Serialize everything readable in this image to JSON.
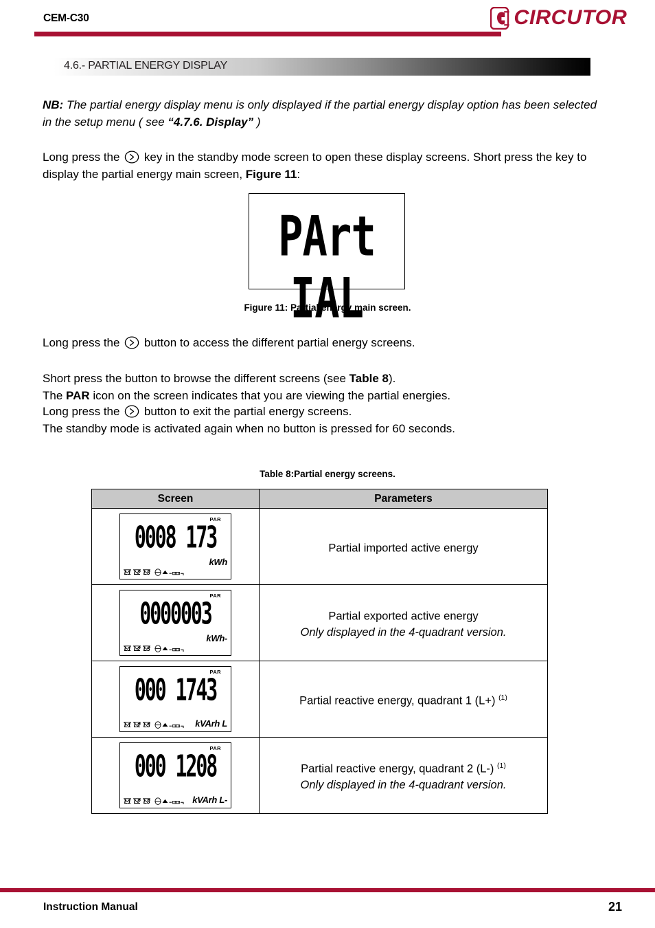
{
  "header": {
    "doc_title": "CEM-C30",
    "brand": "CIRCUTOR",
    "brand_color": "#A81133",
    "rule_color": "#A81133"
  },
  "section": {
    "number": "4.6.-",
    "title": "4.6.- PARTIAL ENERGY DISPLAY"
  },
  "note": {
    "label": "NB:",
    "text_part1": "The partial energy display menu is only displayed if the partial energy display option has been selected in the setup menu ( see ",
    "reference": "“4.7.6. Display”",
    "text_part2": " )"
  },
  "paragraphs": {
    "p1_a": "Long press the ",
    "p1_b": " key in the standby mode screen to open these display screens. Short press the key to display the partial energy main screen, ",
    "p1_bold": "Figure 11",
    "p1_c": ":",
    "p2_a": "Long press the ",
    "p2_b": " button to access the different partial energy screens.",
    "p3_a": "Short press the button to browse the different screens (see ",
    "p3_bold": "Table 8",
    "p3_b": ").",
    "p3_c": "The ",
    "p3_bold2": "PAR",
    "p3_d": " icon on the screen indicates that you are viewing the partial energies.",
    "p4_a": "Long press the ",
    "p4_b": " button to exit the partial energy screens.",
    "p4_c": "The standby mode is activated again when no button is pressed for 60 seconds."
  },
  "figure": {
    "lcd_text": "PArt IAL",
    "caption": "Figure 11: Partial energy main screen."
  },
  "table": {
    "caption": "Table 8:Partial energy screens.",
    "headers": [
      "Screen",
      "Parameters"
    ],
    "rows": [
      {
        "screen": {
          "par": "PAR",
          "digits": "0008 173",
          "phases": [
            "L1",
            "L2",
            "L3"
          ],
          "unit": "kWh",
          "unit_position": "top"
        },
        "param_line1": "Partial imported active energy",
        "param_line2": "",
        "note_marker": ""
      },
      {
        "screen": {
          "par": "PAR",
          "digits": "0000003",
          "phases": [
            "L1",
            "L2",
            "L3"
          ],
          "unit": "kWh-",
          "unit_position": "top"
        },
        "param_line1": "Partial exported active energy",
        "param_line2": "Only displayed in the 4-quadrant version.",
        "note_marker": ""
      },
      {
        "screen": {
          "par": "PAR",
          "digits": "000 1743",
          "phases": [
            "L1",
            "L2",
            "L3"
          ],
          "unit": "kVArh L",
          "unit_position": "bottom"
        },
        "param_line1": "Partial reactive energy, quadrant 1 (L+)",
        "param_line2": "",
        "note_marker": "(1)"
      },
      {
        "screen": {
          "par": "PAR",
          "digits": "000 1208",
          "phases": [
            "L1",
            "L2",
            "L3"
          ],
          "unit": "kVArh L-",
          "unit_position": "bottom"
        },
        "param_line1": "Partial reactive energy, quadrant 2 (L-)",
        "param_line2": "Only displayed in the 4-quadrant version.",
        "note_marker": "(1)"
      }
    ]
  },
  "footer": {
    "left": "Instruction Manual",
    "page": "21",
    "rule_color": "#A81133"
  }
}
